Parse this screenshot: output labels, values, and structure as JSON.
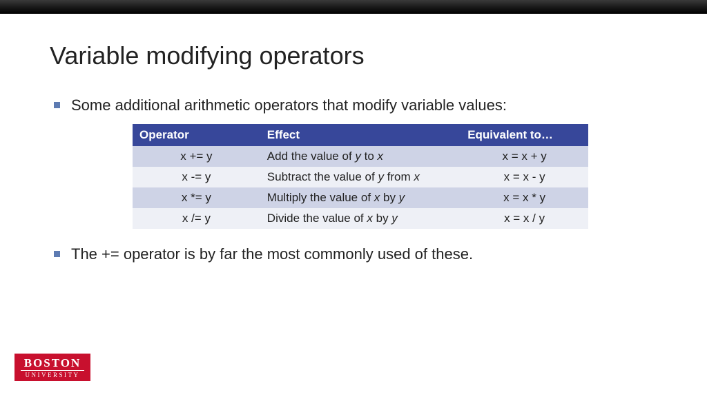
{
  "title": "Variable modifying operators",
  "bullets": {
    "intro": "Some additional arithmetic operators that modify variable values:",
    "outro": "The += operator is by far the most commonly used of these."
  },
  "table": {
    "headers": {
      "operator": "Operator",
      "effect": " Effect",
      "equivalent": "Equivalent to…"
    },
    "rows": [
      {
        "operator": "x += y",
        "effect_pre": "Add the value of ",
        "effect_var1": "y",
        "effect_mid": " to ",
        "effect_var2": "x",
        "effect_post": "",
        "equivalent": "x = x + y"
      },
      {
        "operator": "x -= y",
        "effect_pre": "Subtract the value of ",
        "effect_var1": "y",
        "effect_mid": " from ",
        "effect_var2": "x",
        "effect_post": "",
        "equivalent": "x  = x - y"
      },
      {
        "operator": "x *= y",
        "effect_pre": "Multiply the value of ",
        "effect_var1": "x",
        "effect_mid": " by ",
        "effect_var2": "y",
        "effect_post": "",
        "equivalent": "x  = x * y"
      },
      {
        "operator": "x /= y",
        "effect_pre": "Divide the value of ",
        "effect_var1": "x",
        "effect_mid": " by ",
        "effect_var2": "y",
        "effect_post": "",
        "equivalent": "x  = x / y"
      }
    ]
  },
  "logo": {
    "top": "BOSTON",
    "bottom": "UNIVERSITY"
  }
}
